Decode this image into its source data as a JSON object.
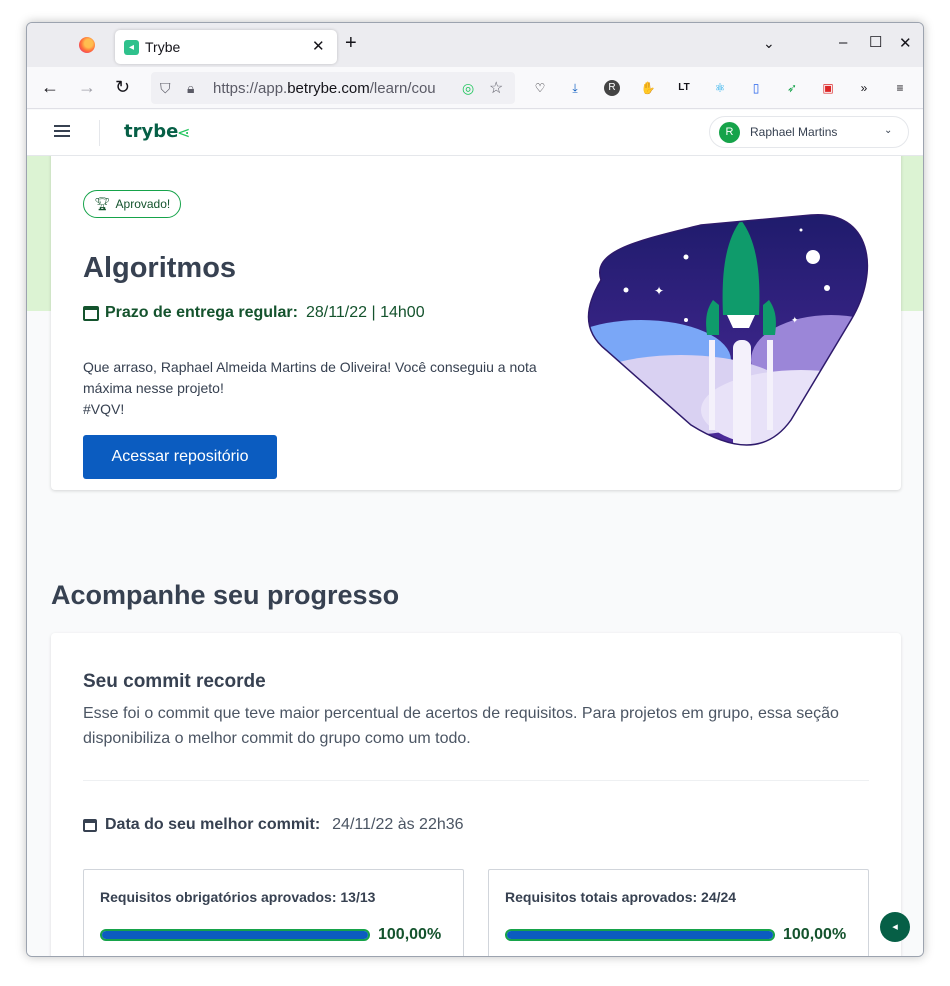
{
  "browser": {
    "tab_title": "Trybe",
    "tab_close": "✕",
    "new_tab": "+",
    "url_prefix": "https://app.",
    "url_domain": "betrybe.com",
    "url_path": "/learn/cou"
  },
  "app": {
    "logo": "trybe",
    "user_initial": "R",
    "user_name": "Raphael Martins"
  },
  "project": {
    "badge": "Aprovado!",
    "title": "Algoritmos",
    "deadline_label": "Prazo de entrega regular:",
    "deadline_value": "28/11/22 | 14h00",
    "congrats_line1": "Que arraso, Raphael Almeida Martins de Oliveira! Você conseguiu a nota máxima nesse projeto!",
    "congrats_line2": "#VQV!",
    "button": "Acessar repositório"
  },
  "progress": {
    "section_title": "Acompanhe seu progresso",
    "card_title": "Seu commit recorde",
    "card_desc": "Esse foi o commit que teve maior percentual de acertos de requisitos. Para projetos em grupo, essa seção disponibiliza o melhor commit do grupo como um todo.",
    "best_commit_label": "Data do seu melhor commit:",
    "best_commit_value": "24/11/22 às 22h36",
    "mandatory": {
      "label": "Requisitos obrigatórios aprovados: 13/13",
      "percent_text": "100,00%",
      "fraction": 1.0
    },
    "total": {
      "label": "Requisitos totais aprovados: 24/24",
      "percent_text": "100,00%",
      "fraction": 1.0
    }
  },
  "colors": {
    "primary_button": "#0b5cc0",
    "success_green": "#16a34a",
    "dark_green": "#14532d",
    "band": "#dcf3d3"
  }
}
